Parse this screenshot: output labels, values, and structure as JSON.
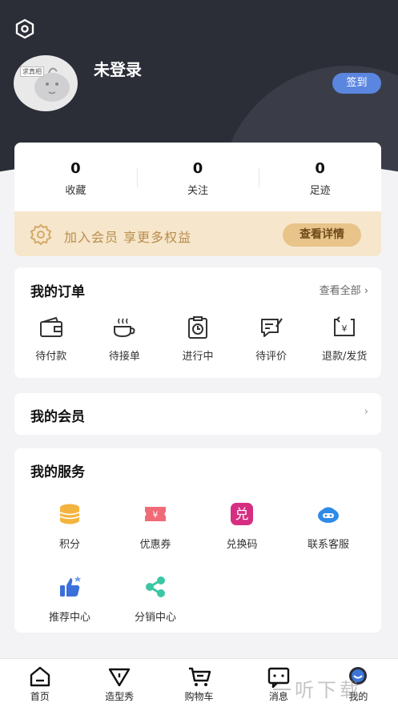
{
  "header": {
    "username": "未登录",
    "checkin_label": "签到",
    "avatar_tag": "求真相"
  },
  "stats": [
    {
      "value": "0",
      "label": "收藏"
    },
    {
      "value": "0",
      "label": "关注"
    },
    {
      "value": "0",
      "label": "足迹"
    }
  ],
  "vip": {
    "text": "加入会员 享更多权益",
    "button": "查看详情"
  },
  "orders": {
    "title": "我的订单",
    "more": "查看全部",
    "items": [
      {
        "label": "待付款",
        "icon": "wallet-icon"
      },
      {
        "label": "待接单",
        "icon": "cup-icon"
      },
      {
        "label": "进行中",
        "icon": "clock-clipboard-icon"
      },
      {
        "label": "待评价",
        "icon": "review-icon"
      },
      {
        "label": "退款/发货",
        "icon": "refund-icon"
      }
    ]
  },
  "member": {
    "title": "我的会员"
  },
  "services": {
    "title": "我的服务",
    "items": [
      {
        "label": "积分",
        "icon": "coins-icon"
      },
      {
        "label": "优惠券",
        "icon": "coupon-icon"
      },
      {
        "label": "兑换码",
        "icon": "redeem-icon",
        "glyph": "兑"
      },
      {
        "label": "联系客服",
        "icon": "headset-icon"
      },
      {
        "label": "推荐中心",
        "icon": "thumbs-up-icon"
      },
      {
        "label": "分销中心",
        "icon": "share-icon"
      }
    ]
  },
  "tabbar": [
    {
      "label": "首页",
      "icon": "home-icon"
    },
    {
      "label": "造型秀",
      "icon": "show-icon"
    },
    {
      "label": "购物车",
      "icon": "cart-icon"
    },
    {
      "label": "消息",
      "icon": "message-icon"
    },
    {
      "label": "我的",
      "icon": "profile-icon"
    }
  ],
  "watermark": "一听下载",
  "colors": {
    "header_bg": "#2b2d37",
    "checkin_bg": "#5b86e0",
    "vip_bg": "#f6e6cb",
    "vip_text": "#b98d4d"
  }
}
